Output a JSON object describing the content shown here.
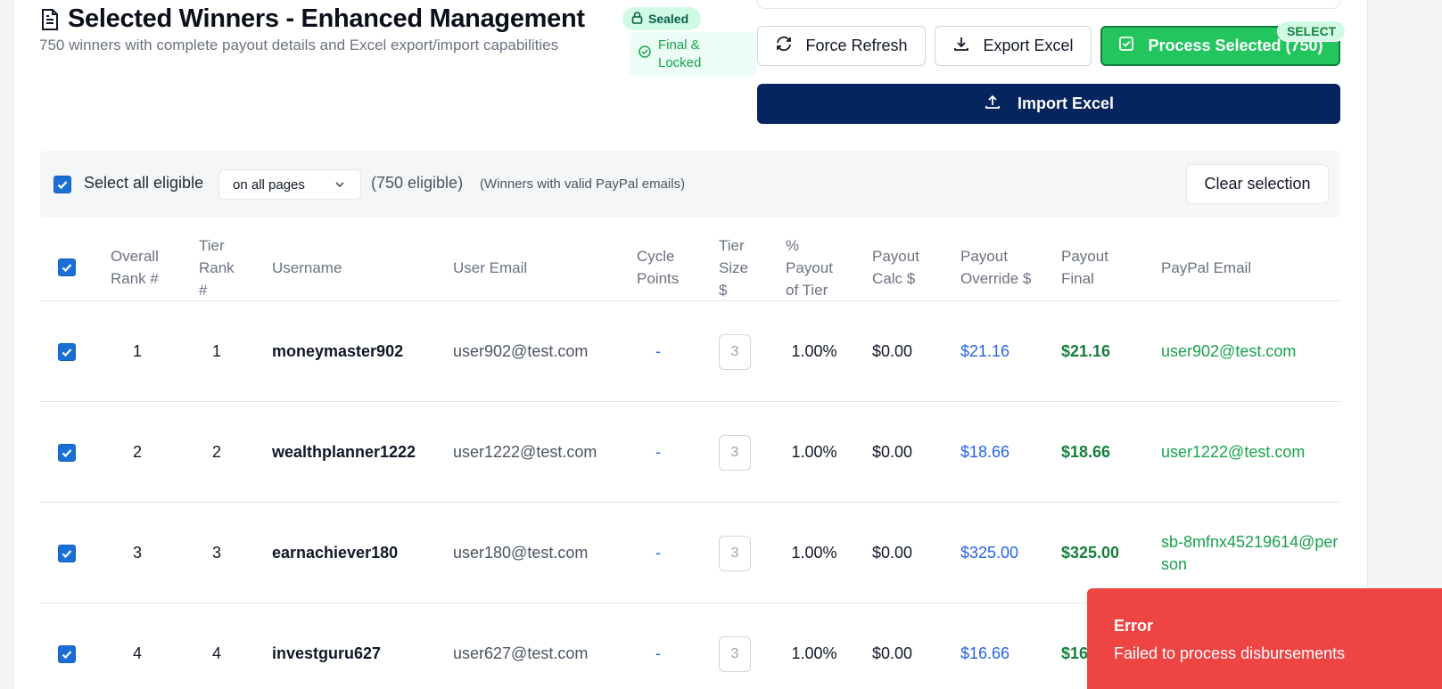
{
  "header": {
    "title": "Selected Winners - Enhanced Management",
    "subtitle": "750 winners with complete payout details and Excel export/import capabilities",
    "badge_sealed": "Sealed",
    "badge_final": "Final & Locked"
  },
  "toolbar": {
    "force_refresh": "Force Refresh",
    "export_excel": "Export Excel",
    "process_selected": "Process Selected (750)",
    "select_pill": "SELECT",
    "import_excel": "Import Excel"
  },
  "selection": {
    "select_all_label": "Select all eligible",
    "scope_value": "on all pages",
    "eligible_count": "(750 eligible)",
    "eligible_note": "(Winners with valid PayPal emails)",
    "clear_selection": "Clear selection"
  },
  "table": {
    "headers": {
      "overall_rank": "Overall Rank #",
      "tier_rank": "Tier Rank #",
      "username": "Username",
      "user_email": "User Email",
      "cycle_points": "Cycle Points",
      "tier_size": "Tier Size $",
      "pct_payout": "% Payout of Tier",
      "payout_calc": "Payout Calc $",
      "payout_override": "Payout Override $",
      "payout_final": "Payout Final",
      "paypal_email": "PayPal Email"
    },
    "rows": [
      {
        "overall": "1",
        "tier": "1",
        "username": "moneymaster902",
        "email": "user902@test.com",
        "points": "-",
        "size": "3",
        "pct": "1.00%",
        "calc": "$0.00",
        "override": "$21.16",
        "final": "$21.16",
        "paypal": "user902@test.com"
      },
      {
        "overall": "2",
        "tier": "2",
        "username": "wealthplanner1222",
        "email": "user1222@test.com",
        "points": "-",
        "size": "3",
        "pct": "1.00%",
        "calc": "$0.00",
        "override": "$18.66",
        "final": "$18.66",
        "paypal": "user1222@test.com"
      },
      {
        "overall": "3",
        "tier": "3",
        "username": "earnachiever180",
        "email": "user180@test.com",
        "points": "-",
        "size": "3",
        "pct": "1.00%",
        "calc": "$0.00",
        "override": "$325.00",
        "final": "$325.00",
        "paypal": "sb-8mfnx45219614@person"
      },
      {
        "overall": "4",
        "tier": "4",
        "username": "investguru627",
        "email": "user627@test.com",
        "points": "-",
        "size": "3",
        "pct": "1.00%",
        "calc": "$0.00",
        "override": "$16.66",
        "final": "$16",
        "paypal": ""
      }
    ]
  },
  "toast": {
    "title": "Error",
    "message": "Failed to process disbursements",
    "color": "#ef4444"
  },
  "colors": {
    "accent_green": "#22c55e",
    "navy": "#06245e",
    "link_blue": "#2563eb"
  }
}
